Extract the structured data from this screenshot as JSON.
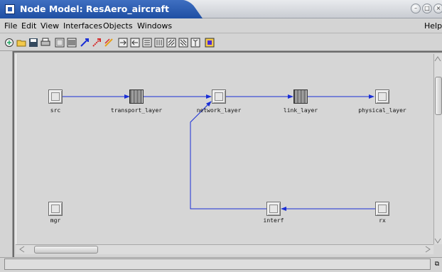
{
  "window": {
    "title": "Node Model: ResAero_aircraft",
    "controls": [
      "minimize-icon",
      "maximize-icon",
      "close-icon"
    ]
  },
  "menu": {
    "items": [
      "File",
      "Edit",
      "View",
      "Interfaces",
      "Objects",
      "Windows"
    ],
    "help": "Help"
  },
  "toolbar": {
    "icons": [
      "open-folder-icon",
      "folder-icon",
      "save-icon",
      "print-icon",
      "queue-node-icon",
      "processor-node-icon",
      "packet-stream-icon",
      "statistic-wire-icon",
      "logical-tap-icon",
      "point-to-point-tx-icon",
      "point-to-point-rx-icon",
      "bus-tx-icon",
      "bus-rx-icon",
      "radio-tx-icon",
      "radio-rx-icon",
      "antenna-icon",
      "module-icon"
    ]
  },
  "nodes": [
    {
      "id": "src",
      "label": "src",
      "kind": "queue"
    },
    {
      "id": "transport_layer",
      "label": "transport_layer",
      "kind": "processor"
    },
    {
      "id": "network_layer",
      "label": "network_layer",
      "kind": "queue"
    },
    {
      "id": "link_layer",
      "label": "link_layer",
      "kind": "processor"
    },
    {
      "id": "physical_layer",
      "label": "physical_layer",
      "kind": "queue"
    },
    {
      "id": "mgr",
      "label": "mgr",
      "kind": "queue"
    },
    {
      "id": "interf",
      "label": "interf",
      "kind": "queue"
    },
    {
      "id": "rx",
      "label": "rx",
      "kind": "queue"
    }
  ],
  "colors": {
    "titlebar": "#2b5bb0",
    "link": "#1a2fd6",
    "canvas": "#d6d6d6"
  },
  "status": {
    "text": ""
  }
}
